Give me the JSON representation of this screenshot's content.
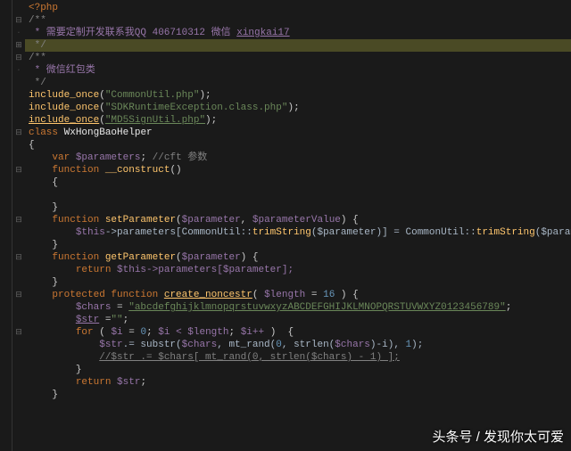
{
  "code": {
    "l1": "<?php",
    "l2a": "/**",
    "l2b": " * 需要定制开发联系我QQ 406710312 微信 ",
    "l2c": "xingkai17",
    "l3": " */",
    "l4a": "/**",
    "l4b": " * 微信红包类",
    "l5": " */",
    "inc1a": "include_once",
    "inc1b": "\"CommonUtil.php\"",
    "inc2b": "\"SDKRuntimeException.class.php\"",
    "inc3b": "\"MD5SignUtil.php\"",
    "cls_kw": "class",
    "cls_name": "WxHongBaoHelper",
    "var_kw": "var",
    "var_name": "$parameters",
    "var_comment": "//cft 参数",
    "fn_kw": "function",
    "fn_construct": "__construct",
    "fn_setparam": "setParameter",
    "sp_p1": "$parameter",
    "sp_p2": "$parameterValue",
    "sp_body1": "$this",
    "sp_body2": "->parameters[CommonUtil::",
    "sp_body3": "trimString",
    "sp_body4": "($parameter)] = CommonUtil::",
    "sp_body5": "trimString",
    "sp_body6": "($parameterValue);",
    "fn_getparam": "getParameter",
    "gp_ret": "return",
    "gp_body": "$this->parameters[$parameter];",
    "prot_kw": "protected function",
    "fn_nonce": "create_noncestr",
    "nonce_p": "$length",
    "nonce_def": "16",
    "chars_var": "$chars",
    "chars_val": "\"abcdefghijklmnopqrstuvwxyzABCDEFGHIJKLMNOPQRSTUVWXYZ0123456789\"",
    "str_var": "$str",
    "str_val": "\"\"",
    "for_kw": "for",
    "for_init": "$i",
    "for_cond1": "0",
    "for_cond2": "$i < $length",
    "for_inc": "$i++",
    "loop1a": "$str",
    "loop1b": ".= substr(",
    "loop1c": "$chars",
    "loop1d": ", mt_rand(",
    "loop1e": "0",
    "loop1f": ", strlen(",
    "loop1g": "$chars",
    "loop1h": ")-",
    "loop1i": "i",
    "loop1j": "), ",
    "loop1k": "1",
    "loop1l": ");",
    "loop2": "//$str .= $chars[ mt_rand(0, strlen($chars) - 1) ];",
    "ret_str": "return",
    "ret_var": "$str"
  },
  "watermark": "头条号 / 发现你太可爱"
}
